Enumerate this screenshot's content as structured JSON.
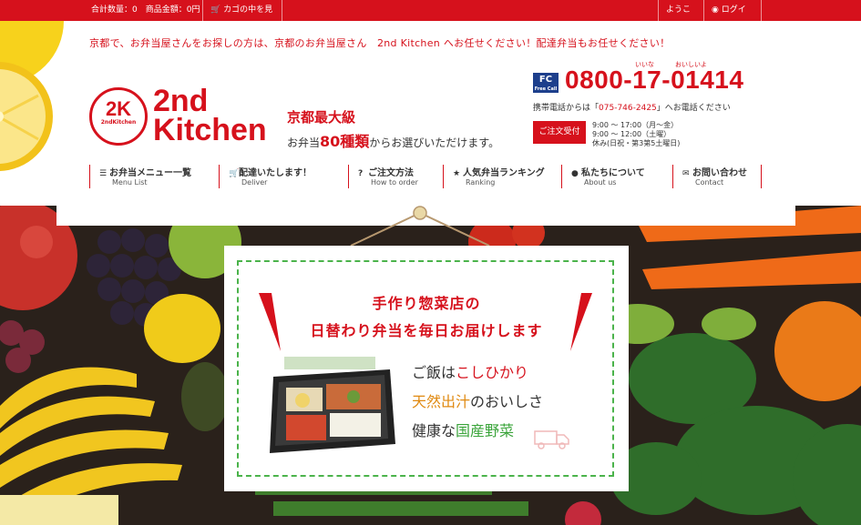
{
  "topbar": {
    "count_label": "合計数量：0　商品金額：0円",
    "cart_label": "カゴの中を見る",
    "welcome": "ようこそ",
    "login": "ログイン"
  },
  "header": {
    "tagline": "京都で、お弁当屋さんをお探しの方は、京都のお弁当屋さん　2nd Kitchen へお任せください！配達弁当もお任せください！",
    "logo_mark": "2K",
    "logo_mark_sub": "2ndKitchen",
    "logo_line1": "2nd",
    "logo_line2": "Kitchen",
    "kyoto_title": "京都最大級",
    "kyoto_pre": "お弁当",
    "kyoto_num": "80種類",
    "kyoto_post": "からお選びいただけます。",
    "freecall_mark": "FC",
    "freecall_small": "Free Call",
    "phone": "0800-17-01414",
    "phone_ruby1": "いいな",
    "phone_ruby2": "おいしいよ",
    "mobile_pre": "携帯電話からは「",
    "mobile_num": "075-746-2425",
    "mobile_post": "」へお電話ください",
    "order_button": "ご注文受付",
    "hours1": "9:00 ～ 17:00（月～金）",
    "hours2": "9:00 ～ 12:00（土曜）",
    "hours3": "休み(日祝・第3第5土曜日)"
  },
  "nav": [
    {
      "icon": "list-icon",
      "glyph": "☰",
      "jp": "お弁当メニュー一覧",
      "en": "Menu List"
    },
    {
      "icon": "cart-icon",
      "glyph": "🛒",
      "jp": "配達いたします！",
      "en": "Deliver"
    },
    {
      "icon": "question-icon",
      "glyph": "?",
      "jp": "ご注文方法",
      "en": "How to order"
    },
    {
      "icon": "star-icon",
      "glyph": "★",
      "jp": "人気弁当ランキング",
      "en": "Ranking"
    },
    {
      "icon": "user-icon",
      "glyph": "●",
      "jp": "私たちについて",
      "en": "About us"
    },
    {
      "icon": "mail-icon",
      "glyph": "✉",
      "jp": "お問い合わせ",
      "en": "Contact"
    }
  ],
  "hero": {
    "catch1": "手作り惣菜店の",
    "catch2": "日替わり弁当を毎日お届けします",
    "l1_pre": "ご飯は",
    "l1_hl": "こしひかり",
    "l2_hl": "天然出汁",
    "l2_post": "のおいしさ",
    "l3_pre": "健康な",
    "l3_hl": "国産野菜"
  },
  "colors": {
    "brand_red": "#d6111c",
    "navy": "#1d3f8c",
    "green": "#4bb34b"
  }
}
